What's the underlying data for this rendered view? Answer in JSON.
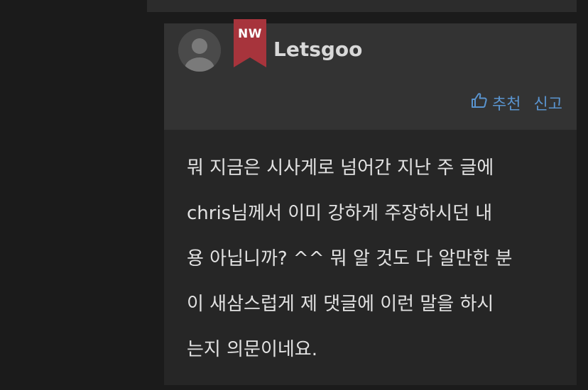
{
  "comment": {
    "author": "Letsgoo",
    "badge": "NW",
    "actions": {
      "recommend_label": "추천",
      "report_label": "신고"
    },
    "body_lines": [
      "뭐 지금은 시사게로 넘어간 지난 주 글에",
      "chris님께서  이미  강하게  주장하시던  내",
      "용 아닙니까? ^^ 뭐 알 것도 다 알만한 분",
      "이 새삼스럽게 제 댓글에 이런 말을 하시",
      "는지 의문이네요."
    ]
  },
  "colors": {
    "page_bg": "#1b1b1b",
    "header_bg": "#333333",
    "body_bg": "#262626",
    "badge": "#a7343c",
    "link": "#5a94cf",
    "text": "#e2e2e2"
  },
  "icons": {
    "avatar": "default-user-avatar",
    "recommend": "thumbs-up-icon"
  }
}
